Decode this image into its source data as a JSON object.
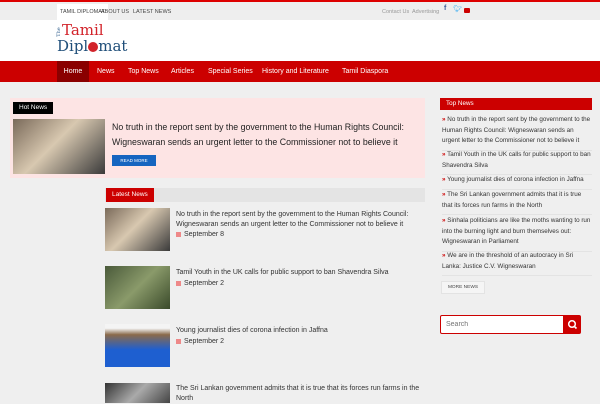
{
  "topbar": {
    "left": [
      "TAMIL DIPLOMAT",
      "ABOUT US",
      "LATEST NEWS"
    ],
    "right": [
      "Contact Us",
      "Advertising"
    ],
    "social": [
      "facebook-icon",
      "twitter-icon",
      "youtube-icon"
    ]
  },
  "logo": {
    "the": "The",
    "line1": "Tamil",
    "line2a": "Dipl",
    "line2b": "mat"
  },
  "nav": [
    "Home",
    "News",
    "Top News",
    "Articles",
    "Special Series",
    "History and Literature",
    "Tamil Diaspora"
  ],
  "hot": {
    "label": "Hot News",
    "title": "No truth in the report sent by the government to the Human Rights Council: Wigneswaran sends an urgent letter to the Commissioner not to believe it",
    "button": "READ MORE"
  },
  "latest": {
    "label": "Latest News",
    "items": [
      {
        "title": "No truth in the report sent by the government to the Human Rights Council: Wigneswaran sends an urgent letter to the Commissioner not to believe it",
        "date": "September 8"
      },
      {
        "title": "Tamil Youth in the UK calls for public support to ban Shavendra Silva",
        "date": "September 2"
      },
      {
        "title": "Young journalist dies of corona infection in Jaffna",
        "date": "September 2"
      },
      {
        "title": "The Sri Lankan government admits that it is true that its forces run farms in the North",
        "date": ""
      }
    ]
  },
  "sidebar": {
    "label": "Top News",
    "items": [
      "No truth in the report sent by the government to the Human Rights Council: Wigneswaran sends an urgent letter to the Commissioner not to believe it",
      "Tamil Youth in the UK calls for public support to ban Shavendra Silva",
      "Young journalist dies of corona infection in Jaffna",
      "The Sri Lankan government admits that it is true that its forces run farms in the North",
      "Sinhala politicians are like the moths wanting to run into the burning light and burn themselves out: Wigneswaran in Parliament",
      "We are in the threshold of an autocracy in Sri Lanka: Justice C.V. Wigneswaran"
    ],
    "more": "MORE NEWS",
    "search_placeholder": "Search"
  }
}
